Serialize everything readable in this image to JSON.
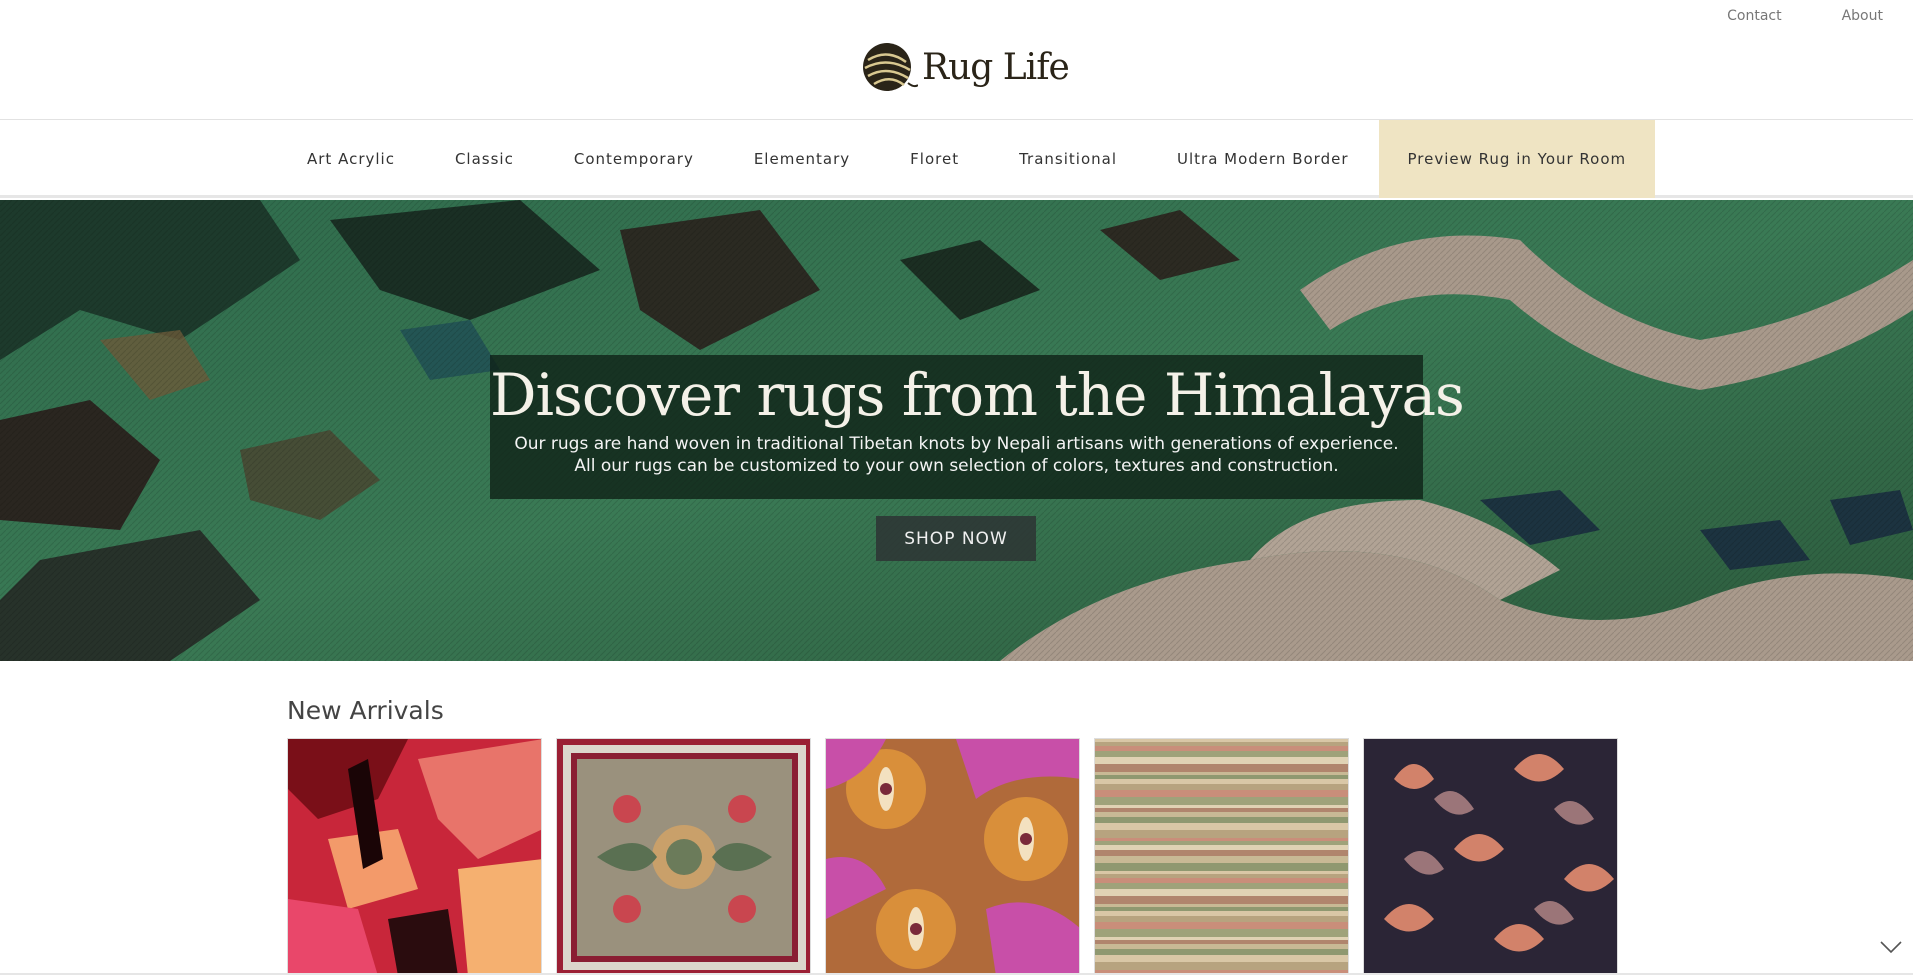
{
  "top_links": {
    "contact": "Contact",
    "about": "About"
  },
  "brand": {
    "name": "Rug Life"
  },
  "nav": {
    "items": [
      {
        "label": "Art Acrylic"
      },
      {
        "label": "Classic"
      },
      {
        "label": "Contemporary"
      },
      {
        "label": "Elementary"
      },
      {
        "label": "Floret"
      },
      {
        "label": "Transitional"
      },
      {
        "label": "Ultra Modern Border"
      },
      {
        "label": "Preview Rug in Your Room"
      }
    ],
    "highlight_color": "#efe4c3"
  },
  "hero": {
    "title": "Discover rugs from the Himalayas",
    "subtitle_line1": "Our rugs are hand woven in traditional Tibetan knots by Nepali artisans with generations of experience.",
    "subtitle_line2": "All our rugs can be customized to your own selection of colors, textures and construction.",
    "cta": "SHOP NOW"
  },
  "arrivals": {
    "title": "New Arrivals",
    "items": [
      {
        "icon": "abstract-red-rug-image"
      },
      {
        "icon": "classic-floral-rug-image"
      },
      {
        "icon": "floret-rug-image"
      },
      {
        "icon": "striped-rug-image"
      },
      {
        "icon": "damask-navy-rug-image"
      }
    ]
  },
  "icons": {
    "scroll": "chevron-down-icon",
    "logo": "yarn-ball-icon"
  }
}
